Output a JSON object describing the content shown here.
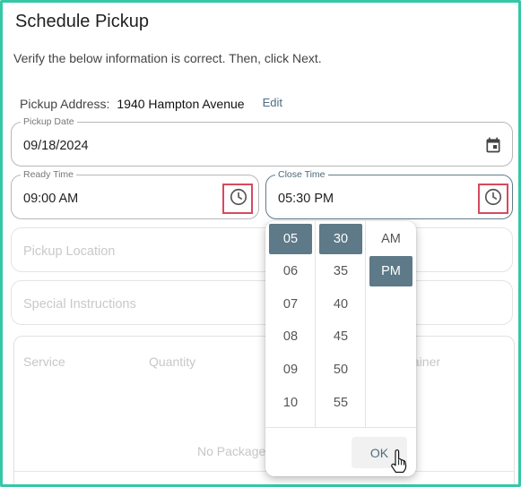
{
  "dialog": {
    "title": "Schedule Pickup",
    "subtitle": "Verify the below information is correct. Then, click Next."
  },
  "address": {
    "label": "Pickup Address:",
    "value": "1940 Hampton Avenue",
    "edit_label": "Edit"
  },
  "pickup_date": {
    "label": "Pickup Date",
    "value": "09/18/2024",
    "icon": "calendar-icon"
  },
  "ready_time": {
    "label": "Ready Time",
    "value": "09:00 AM",
    "icon": "clock-icon"
  },
  "close_time": {
    "label": "Close Time",
    "value": "05:30 PM",
    "icon": "clock-icon"
  },
  "pickup_location": {
    "placeholder": "Pickup Location"
  },
  "special_instructions": {
    "placeholder": "Special Instructions"
  },
  "packages_table": {
    "columns": [
      "Service",
      "Quantity",
      "tainer"
    ],
    "empty_text": "No Packages"
  },
  "time_picker": {
    "hours": [
      "05",
      "06",
      "07",
      "08",
      "09",
      "10"
    ],
    "minutes": [
      "30",
      "35",
      "40",
      "45",
      "50",
      "55"
    ],
    "periods": [
      "AM",
      "PM"
    ],
    "selected_hour": "05",
    "selected_minute": "30",
    "selected_period": "PM",
    "ok_label": "OK"
  },
  "colors": {
    "frame_border": "#35c7a6",
    "accent": "#5e7987",
    "highlight": "#d64a5f"
  }
}
